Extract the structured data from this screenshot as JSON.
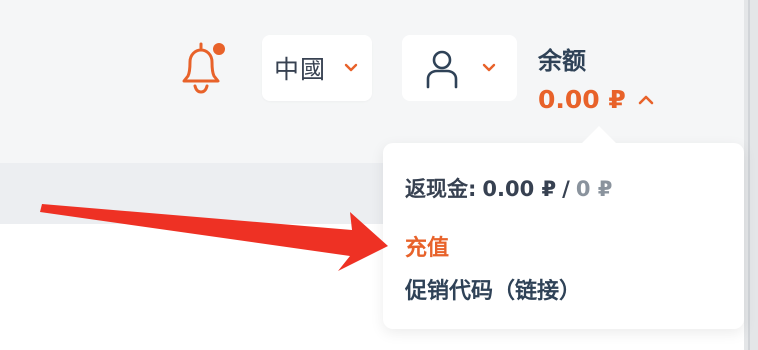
{
  "header": {
    "notifications": {
      "icon": "bell-icon",
      "has_unread": true
    },
    "language": {
      "selected": "中國",
      "chevron_icon": "chevron-down-icon"
    },
    "account": {
      "icon": "user-icon",
      "chevron_icon": "chevron-down-icon"
    },
    "balance": {
      "title": "余额",
      "amount": "0.00 ₽",
      "expanded_icon": "chevron-up-icon"
    }
  },
  "balance_dropdown": {
    "cashback_label": "返现金:",
    "cashback_value": "0.00 ₽",
    "cashback_separator": "/",
    "cashback_pending": "0 ₽",
    "topup_link": "充值",
    "promo_link": "促销代码（链接）"
  },
  "colors": {
    "accent": "#e8622a",
    "text_dark": "#2f4257",
    "annotation_arrow": "#ee3124"
  }
}
